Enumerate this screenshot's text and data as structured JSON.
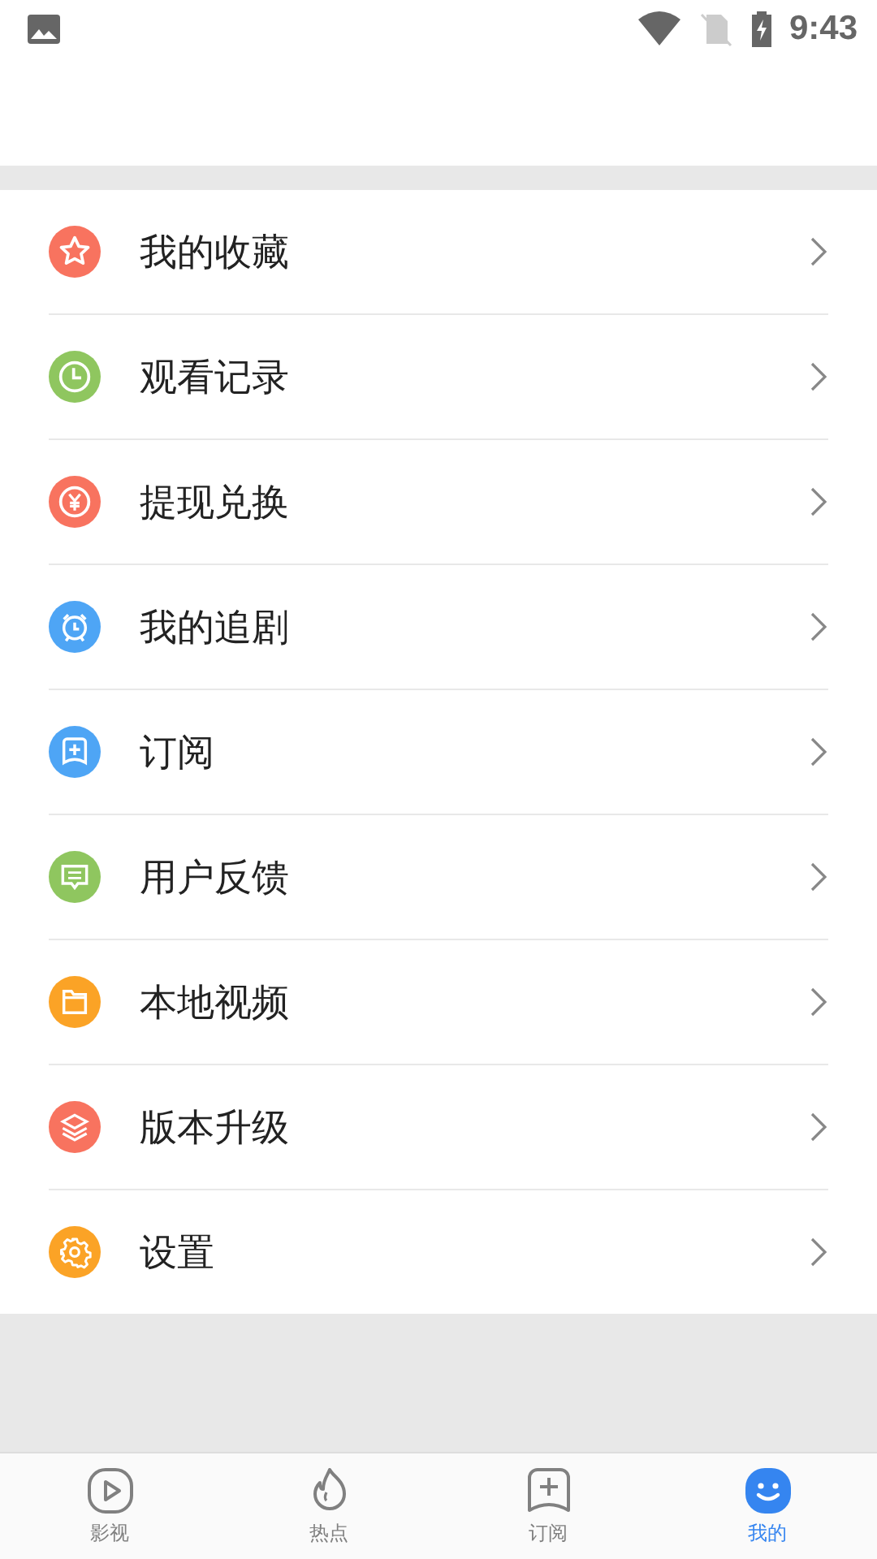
{
  "status_bar": {
    "time": "9:43"
  },
  "menu": [
    {
      "label": "我的收藏",
      "kind": "star",
      "color": "#f8735f"
    },
    {
      "label": "观看记录",
      "kind": "clock",
      "color": "#8fc65f"
    },
    {
      "label": "提现兑换",
      "kind": "yen",
      "color": "#f8735f"
    },
    {
      "label": "我的追剧",
      "kind": "alarm",
      "color": "#4ea5f5"
    },
    {
      "label": "订阅",
      "kind": "subscribe",
      "color": "#4ea5f5"
    },
    {
      "label": "用户反馈",
      "kind": "feedback",
      "color": "#8fc65f"
    },
    {
      "label": "本地视频",
      "kind": "folder",
      "color": "#fba326"
    },
    {
      "label": "版本升级",
      "kind": "layers",
      "color": "#f8735f"
    },
    {
      "label": "设置",
      "kind": "gear",
      "color": "#fba326"
    }
  ],
  "tabs": [
    {
      "label": "影视",
      "kind": "play",
      "selected": false
    },
    {
      "label": "热点",
      "kind": "flame",
      "selected": false
    },
    {
      "label": "订阅",
      "kind": "subscribe",
      "selected": false
    },
    {
      "label": "我的",
      "kind": "face",
      "selected": true
    }
  ]
}
